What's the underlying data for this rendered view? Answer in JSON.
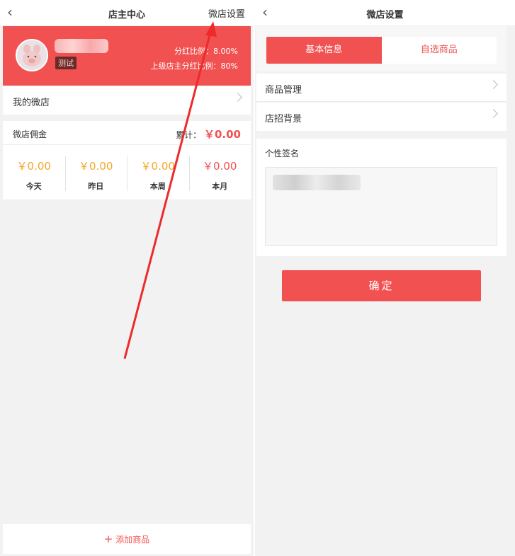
{
  "left": {
    "nav": {
      "title": "店主中心",
      "right": "微店设置",
      "back_icon": "‹"
    },
    "profile": {
      "badge": "测试",
      "dividend_rate": "分红比例：8.00%",
      "upper_rate": "上级店主分红比例：80%"
    },
    "my_shop": "我的微店",
    "commission": {
      "title": "微店佣金",
      "total_label": "累计：",
      "total_value": "￥0.00",
      "stats": [
        {
          "value": "￥0.00",
          "label": "今天"
        },
        {
          "value": "￥0.00",
          "label": "昨日"
        },
        {
          "value": "￥0.00",
          "label": "本周"
        },
        {
          "value": "￥0.00",
          "label": "本月"
        }
      ]
    },
    "add_button": "添加商品",
    "add_icon": "+"
  },
  "right": {
    "nav": {
      "title": "微店设置",
      "back_icon": "‹"
    },
    "tabs": [
      "基本信息",
      "自选商品"
    ],
    "rows": [
      "商品管理",
      "店招背景"
    ],
    "signature_label": "个性签名",
    "confirm": "确定"
  },
  "colors": {
    "accent": "#f15151",
    "amount": "#f5a623",
    "background": "#f2f2f2"
  }
}
